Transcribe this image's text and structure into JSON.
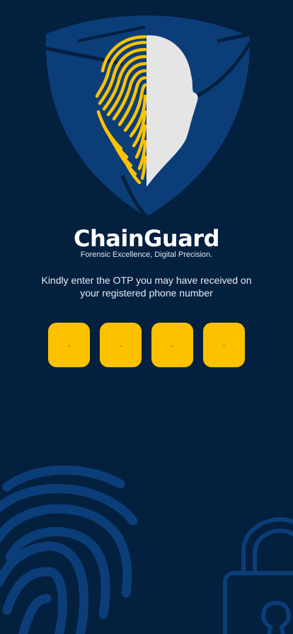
{
  "app": {
    "brand": "ChainGuard",
    "tagline": "Forensic Excellence, Digital Precision."
  },
  "otp": {
    "instruction": "Kindly enter the OTP you may have received on your registered phone number",
    "digit_count": 4,
    "placeholder": "-",
    "values": [
      "",
      "",
      "",
      ""
    ]
  },
  "icons": {
    "logo": "shield-fingerprint-face-icon",
    "background_left": "fingerprint-icon",
    "background_right": "padlock-icon"
  },
  "colors": {
    "background": "#04203f",
    "accent": "#fcc200",
    "shield": "#0b3e78",
    "face": "#e5e5e5",
    "decoration": "#0b3e78"
  }
}
